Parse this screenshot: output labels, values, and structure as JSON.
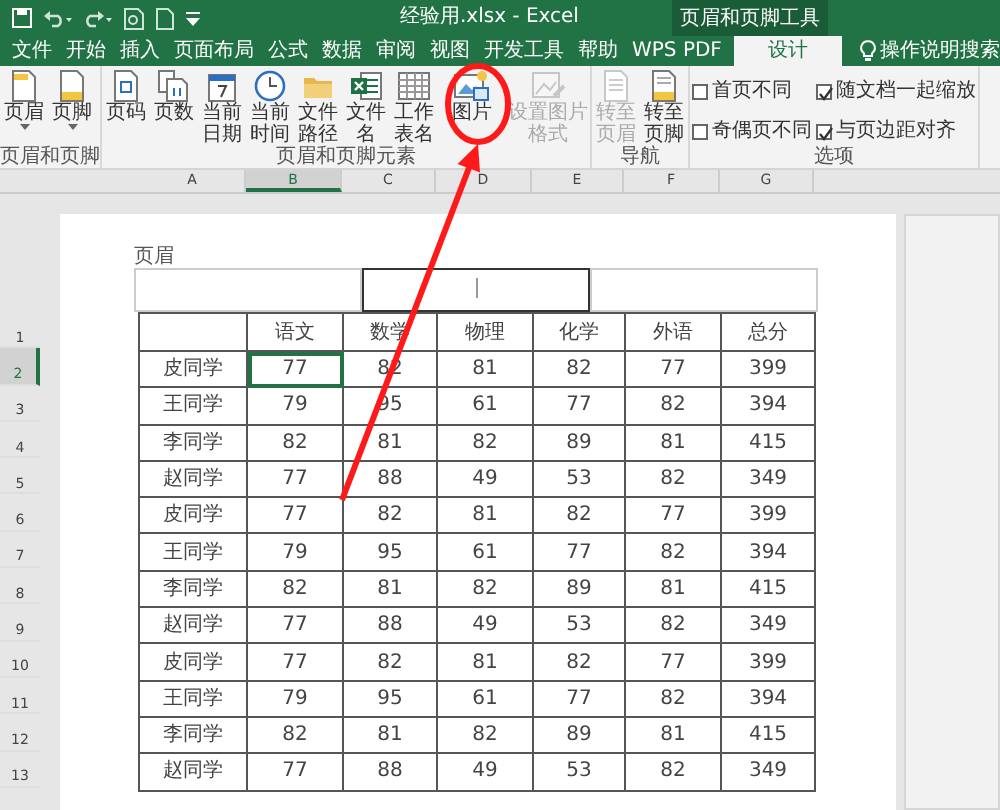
{
  "window": {
    "title": "经验用.xlsx - Excel",
    "context_label": "页眉和页脚工具"
  },
  "tabs": [
    {
      "label": "文件",
      "selected": false
    },
    {
      "label": "开始",
      "selected": false
    },
    {
      "label": "插入",
      "selected": false
    },
    {
      "label": "页面布局",
      "selected": false
    },
    {
      "label": "公式",
      "selected": false
    },
    {
      "label": "数据",
      "selected": false
    },
    {
      "label": "审阅",
      "selected": false
    },
    {
      "label": "视图",
      "selected": false
    },
    {
      "label": "开发工具",
      "selected": false
    },
    {
      "label": "帮助",
      "selected": false
    },
    {
      "label": "WPS PDF",
      "selected": false
    },
    {
      "label": "设计",
      "selected": true
    }
  ],
  "search": {
    "label": "操作说明搜索"
  },
  "ribbon": {
    "groups": [
      {
        "label": "页眉和页脚",
        "buttons": [
          {
            "label": "页眉",
            "kind": "header",
            "dropdown": true,
            "disabled": false
          },
          {
            "label": "页脚",
            "kind": "footer",
            "dropdown": true,
            "disabled": false
          }
        ]
      },
      {
        "label": "页眉和页脚元素",
        "buttons": [
          {
            "label": "页码",
            "kind": "page-number",
            "dropdown": false,
            "disabled": false
          },
          {
            "label": "页数",
            "kind": "page-count",
            "dropdown": false,
            "disabled": false
          },
          {
            "label": "当前日期",
            "kind": "date",
            "dropdown": false,
            "disabled": false
          },
          {
            "label": "当前时间",
            "kind": "time",
            "dropdown": false,
            "disabled": false
          },
          {
            "label": "文件路径",
            "kind": "path",
            "dropdown": false,
            "disabled": false
          },
          {
            "label": "文件名",
            "kind": "filename",
            "dropdown": false,
            "disabled": false
          },
          {
            "label": "工作表名",
            "kind": "sheet-name",
            "dropdown": false,
            "disabled": false
          },
          {
            "label": "图片",
            "kind": "picture",
            "dropdown": false,
            "disabled": false
          },
          {
            "label": "设置图片格式",
            "kind": "picture-format",
            "dropdown": false,
            "disabled": true
          }
        ]
      },
      {
        "label": "导航",
        "buttons": [
          {
            "label": "转至页眉",
            "kind": "goto-header",
            "dropdown": false,
            "disabled": true
          },
          {
            "label": "转至页脚",
            "kind": "goto-footer",
            "dropdown": false,
            "disabled": false
          }
        ]
      },
      {
        "label": "选项",
        "checkboxes": [
          {
            "label": "首页不同",
            "checked": false
          },
          {
            "label": "奇偶页不同",
            "checked": false
          },
          {
            "label": "随文档一起缩放",
            "checked": true
          },
          {
            "label": "与页边距对齐",
            "checked": true
          }
        ]
      }
    ]
  },
  "sheet": {
    "columns": [
      {
        "label": "A",
        "selected": false
      },
      {
        "label": "B",
        "selected": true
      },
      {
        "label": "C",
        "selected": false
      },
      {
        "label": "D",
        "selected": false
      },
      {
        "label": "E",
        "selected": false
      },
      {
        "label": "F",
        "selected": false
      },
      {
        "label": "G",
        "selected": false
      }
    ],
    "row_numbers": [
      {
        "label": "1",
        "selected": false
      },
      {
        "label": "2",
        "selected": true
      },
      {
        "label": "3",
        "selected": false
      },
      {
        "label": "4",
        "selected": false
      },
      {
        "label": "5",
        "selected": false
      },
      {
        "label": "6",
        "selected": false
      },
      {
        "label": "7",
        "selected": false
      },
      {
        "label": "8",
        "selected": false
      },
      {
        "label": "9",
        "selected": false
      },
      {
        "label": "10",
        "selected": false
      },
      {
        "label": "11",
        "selected": false
      },
      {
        "label": "12",
        "selected": false
      },
      {
        "label": "13",
        "selected": false
      }
    ],
    "header_label": "页眉",
    "table": {
      "headings": [
        "语文",
        "数学",
        "物理",
        "化学",
        "外语",
        "总分"
      ],
      "rows": [
        {
          "name": "皮同学",
          "cells": [
            {
              "text": "77",
              "selected": true
            },
            {
              "text": "82",
              "selected": false
            },
            {
              "text": "81",
              "selected": false
            },
            {
              "text": "82",
              "selected": false
            },
            {
              "text": "77",
              "selected": false
            },
            {
              "text": "399",
              "selected": false
            }
          ]
        },
        {
          "name": "王同学",
          "cells": [
            {
              "text": "79",
              "selected": false
            },
            {
              "text": "95",
              "selected": false
            },
            {
              "text": "61",
              "selected": false
            },
            {
              "text": "77",
              "selected": false
            },
            {
              "text": "82",
              "selected": false
            },
            {
              "text": "394",
              "selected": false
            }
          ]
        },
        {
          "name": "李同学",
          "cells": [
            {
              "text": "82",
              "selected": false
            },
            {
              "text": "81",
              "selected": false
            },
            {
              "text": "82",
              "selected": false
            },
            {
              "text": "89",
              "selected": false
            },
            {
              "text": "81",
              "selected": false
            },
            {
              "text": "415",
              "selected": false
            }
          ]
        },
        {
          "name": "赵同学",
          "cells": [
            {
              "text": "77",
              "selected": false
            },
            {
              "text": "88",
              "selected": false
            },
            {
              "text": "49",
              "selected": false
            },
            {
              "text": "53",
              "selected": false
            },
            {
              "text": "82",
              "selected": false
            },
            {
              "text": "349",
              "selected": false
            }
          ]
        },
        {
          "name": "皮同学",
          "cells": [
            {
              "text": "77",
              "selected": false
            },
            {
              "text": "82",
              "selected": false
            },
            {
              "text": "81",
              "selected": false
            },
            {
              "text": "82",
              "selected": false
            },
            {
              "text": "77",
              "selected": false
            },
            {
              "text": "399",
              "selected": false
            }
          ]
        },
        {
          "name": "王同学",
          "cells": [
            {
              "text": "79",
              "selected": false
            },
            {
              "text": "95",
              "selected": false
            },
            {
              "text": "61",
              "selected": false
            },
            {
              "text": "77",
              "selected": false
            },
            {
              "text": "82",
              "selected": false
            },
            {
              "text": "394",
              "selected": false
            }
          ]
        },
        {
          "name": "李同学",
          "cells": [
            {
              "text": "82",
              "selected": false
            },
            {
              "text": "81",
              "selected": false
            },
            {
              "text": "82",
              "selected": false
            },
            {
              "text": "89",
              "selected": false
            },
            {
              "text": "81",
              "selected": false
            },
            {
              "text": "415",
              "selected": false
            }
          ]
        },
        {
          "name": "赵同学",
          "cells": [
            {
              "text": "77",
              "selected": false
            },
            {
              "text": "88",
              "selected": false
            },
            {
              "text": "49",
              "selected": false
            },
            {
              "text": "53",
              "selected": false
            },
            {
              "text": "82",
              "selected": false
            },
            {
              "text": "349",
              "selected": false
            }
          ]
        },
        {
          "name": "皮同学",
          "cells": [
            {
              "text": "77",
              "selected": false
            },
            {
              "text": "82",
              "selected": false
            },
            {
              "text": "81",
              "selected": false
            },
            {
              "text": "82",
              "selected": false
            },
            {
              "text": "77",
              "selected": false
            },
            {
              "text": "399",
              "selected": false
            }
          ]
        },
        {
          "name": "王同学",
          "cells": [
            {
              "text": "79",
              "selected": false
            },
            {
              "text": "95",
              "selected": false
            },
            {
              "text": "61",
              "selected": false
            },
            {
              "text": "77",
              "selected": false
            },
            {
              "text": "82",
              "selected": false
            },
            {
              "text": "394",
              "selected": false
            }
          ]
        },
        {
          "name": "李同学",
          "cells": [
            {
              "text": "82",
              "selected": false
            },
            {
              "text": "81",
              "selected": false
            },
            {
              "text": "82",
              "selected": false
            },
            {
              "text": "89",
              "selected": false
            },
            {
              "text": "81",
              "selected": false
            },
            {
              "text": "415",
              "selected": false
            }
          ]
        },
        {
          "name": "赵同学",
          "cells": [
            {
              "text": "77",
              "selected": false
            },
            {
              "text": "88",
              "selected": false
            },
            {
              "text": "49",
              "selected": false
            },
            {
              "text": "53",
              "selected": false
            },
            {
              "text": "82",
              "selected": false
            },
            {
              "text": "349",
              "selected": false
            }
          ]
        }
      ]
    }
  }
}
